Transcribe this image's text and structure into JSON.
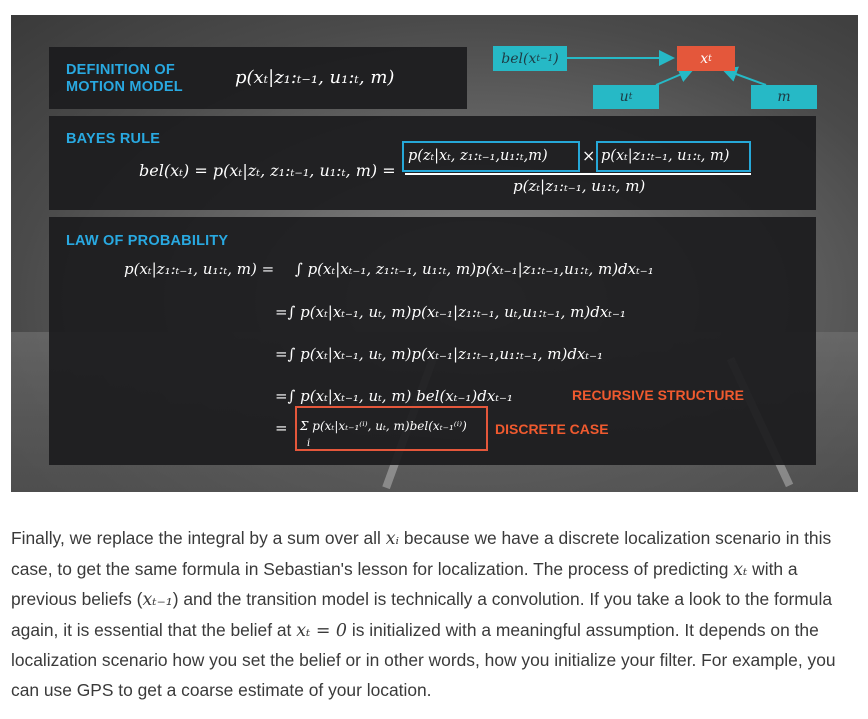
{
  "slide": {
    "diagram": {
      "node_bel_prev": "bel(x",
      "node_bel_prev_sub": "t−1",
      "node_bel_prev_close": ")",
      "node_xt": "x",
      "node_xt_sub": "t",
      "node_ut": "u",
      "node_ut_sub": "t",
      "node_m": "m",
      "colors": {
        "teal": "#26b9c6",
        "orange": "#e4573b"
      }
    },
    "motion_model": {
      "heading_line1": "DEFINITION OF",
      "heading_line2": "MOTION MODEL",
      "formula": "p(xₜ|z₁:ₜ₋₁, u₁:ₜ, m)"
    },
    "bayes_rule": {
      "heading": "BAYES RULE",
      "lhs": "bel(xₜ) = p(xₜ|zₜ, z₁:ₜ₋₁, u₁:ₜ, m) =",
      "numerator_left": "p(zₜ|xₜ, z₁:ₜ₋₁,u₁:ₜ,m)",
      "times": "×",
      "numerator_right": "p(xₜ|z₁:ₜ₋₁, u₁:ₜ, m)",
      "denominator": "p(zₜ|z₁:ₜ₋₁, u₁:ₜ, m)"
    },
    "law_of_probability": {
      "heading": "LAW OF PROBABILITY",
      "line1_lhs": "p(xₜ|z₁:ₜ₋₁, u₁:ₜ, m) =",
      "line1_rhs": "∫ p(xₜ|xₜ₋₁, z₁:ₜ₋₁, u₁:ₜ, m)p(xₜ₋₁|z₁:ₜ₋₁,u₁:ₜ, m)dxₜ₋₁",
      "line2": "=∫ p(xₜ|xₜ₋₁, uₜ, m)p(xₜ₋₁|z₁:ₜ₋₁, uₜ,u₁:ₜ₋₁, m)dxₜ₋₁",
      "line3": "=∫ p(xₜ|xₜ₋₁, uₜ, m)p(xₜ₋₁|z₁:ₜ₋₁,u₁:ₜ₋₁, m)dxₜ₋₁",
      "line4": "=∫ p(xₜ|xₜ₋₁, uₜ, m) bel(xₜ₋₁)dxₜ₋₁",
      "line4_label": "RECURSIVE STRUCTURE",
      "line5_eq": "=",
      "line5": "Σ p(xₜ|xₜ₋₁⁽ⁱ⁾, uₜ, m)bel(xₜ₋₁⁽ⁱ⁾)",
      "line5_index": "i",
      "line5_label": "DISCRETE CASE"
    }
  },
  "paragraph": {
    "p1": "Finally, we replace the integral by a sum over all ",
    "m1": "xᵢ",
    "p2": " because we have a discrete localization scenario in this case, to get the same formula in Sebastian's lesson for localization. The process of predicting ",
    "m2": "xₜ",
    "p3": " with a previous beliefs (",
    "m3": "xₜ₋₁",
    "p4": ") and the transition model is technically a convolution. If you take a look to the formula again, it is essential that the belief at ",
    "m4": "xₜ = 0",
    "p5": " is initialized with a meaningful assumption. It depends on the localization scenario how you set the belief or in other words, how you initialize your filter. For example, you can use GPS to get a coarse estimate of your location."
  }
}
